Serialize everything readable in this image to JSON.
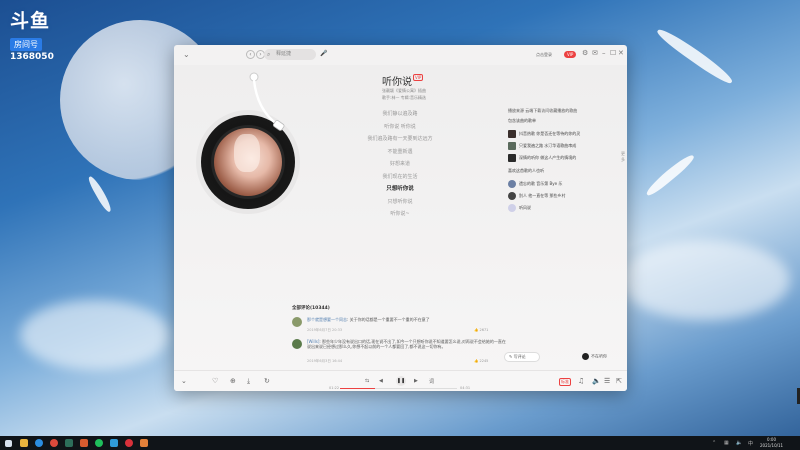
{
  "overlay": {
    "logo": "斗鱼",
    "room_label": "房间号",
    "room_number": "1368050"
  },
  "window": {
    "search_placeholder": "释延捷",
    "login_text": "点击登录",
    "vip_label": "VIP",
    "song": {
      "title": "听你说",
      "tag": "VIP",
      "meta_line1": "张靓颖《爱情公寓》插曲",
      "meta_line2": "歌手:林一 专辑:音乐精选"
    },
    "lyrics": [
      "我们静以遍及路",
      "听你说 听你说",
      "我们遍及路有一天要到达远方",
      "不能重新遇",
      "好想来道",
      "我们现在的生活",
      "只想听你说",
      "只想听你说",
      "听你说~"
    ],
    "active_lyric_index": 6,
    "right": {
      "header": "播放来源 云端下载访问收藏播放的歌曲",
      "sub": "包含该曲的歌单",
      "playlists": [
        "抖音热歌 你是否还在等待的你的灵",
        "只爱我遍之路 水汀华语歌曲串成",
        "深情的听你 做这人产生的情境的"
      ],
      "similar_head": "喜欢这首歌的人也听",
      "similar": [
        "遗忘的歌 音乐第 Bye 乐",
        "别人 他一直在等 那些乡村",
        "听风说"
      ],
      "more_label": "更多"
    },
    "comments": {
      "title": "全部评论(10344)",
      "items": [
        {
          "user": "那个就是想要一个同志",
          "text": "关于你的话都是一个重要不一个重的不在意了",
          "time": "2019年6月7日 20:33",
          "likes": "2671"
        },
        {
          "user": "[Wills]",
          "text": "那些年少年没有说出口的话,现在说不出了,如今一个只想听你说不知道要怎么说,对再说不会给她的一直在说出来说已经想过那么久,你想不起以前的一个人都要回了,都不说这一切你有。",
          "time": "2019年6月3日 16:44",
          "likes": "2245"
        }
      ],
      "write_label": "写评论",
      "mini_user": "不在听你"
    },
    "player": {
      "current_time": "01:22",
      "total_time": "04:31",
      "progress": 0.3,
      "quality": "标准"
    }
  },
  "taskbar": {
    "time": "0:00",
    "date": "2021/10/11"
  },
  "colors": {
    "accent": "#ec4141",
    "link": "#507daf"
  }
}
